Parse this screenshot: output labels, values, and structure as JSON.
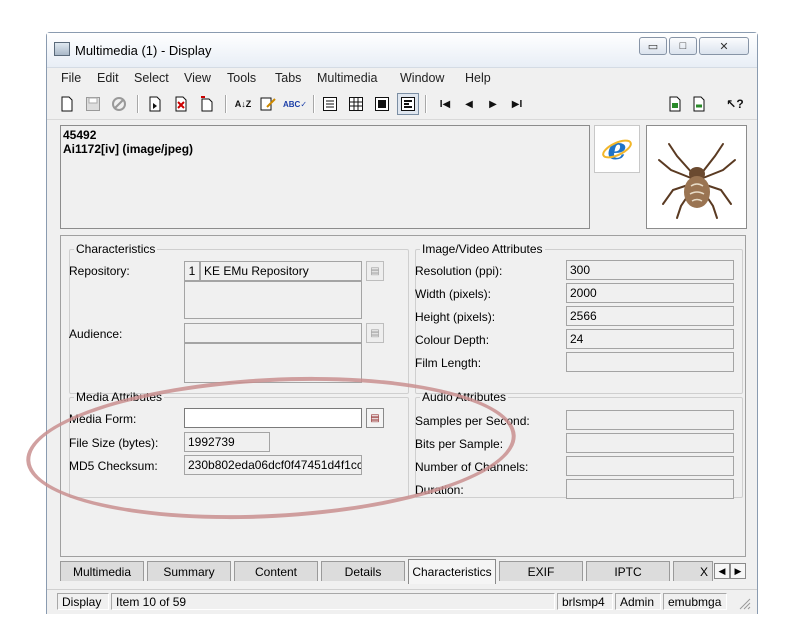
{
  "window": {
    "title": "Multimedia (1) - Display",
    "minimize": "▭",
    "maximize": "□",
    "close": "✕"
  },
  "menu": [
    "File",
    "Edit",
    "Select",
    "View",
    "Tools",
    "Tabs",
    "Multimedia",
    "Window",
    "Help"
  ],
  "toolbar_icons": [
    "new-record-icon",
    "save-icon",
    "cancel-icon",
    "search-icon",
    "delete-icon",
    "copy-icon",
    "sort-icon",
    "edit-icon",
    "spellcheck-icon",
    "list-view-icon",
    "table-view-icon",
    "page-view-icon",
    "detail-view-icon",
    "first-record-icon",
    "previous-record-icon",
    "next-record-icon",
    "last-record-icon",
    "attach-icon",
    "export-icon",
    "help-icon"
  ],
  "toolbar_glyphs": {
    "sort": "A↓Z",
    "spell": "ABC✓",
    "first": "I◀",
    "prev": "◀",
    "next": "▶",
    "last": "▶I",
    "help": "↖?"
  },
  "header": {
    "line1": "45492",
    "line2": "Ai1172[iv] (image/jpeg)"
  },
  "characteristics": {
    "legend": "Characteristics",
    "repository_label": "Repository:",
    "repository_index": "1",
    "repository_value": "KE EMu Repository",
    "audience_label": "Audience:"
  },
  "image_video": {
    "legend": "Image/Video Attributes",
    "fields": [
      {
        "label": "Resolution (ppi):",
        "value": "300"
      },
      {
        "label": "Width (pixels):",
        "value": "2000"
      },
      {
        "label": "Height (pixels):",
        "value": "2566"
      },
      {
        "label": "Colour Depth:",
        "value": "24"
      },
      {
        "label": "Film Length:",
        "value": ""
      }
    ]
  },
  "media": {
    "legend": "Media Attributes",
    "form_label": "Media Form:",
    "form_value": "",
    "size_label": "File Size (bytes):",
    "size_value": "1992739",
    "md5_label": "MD5 Checksum:",
    "md5_value": "230b802eda06dcf0f47451d4f1cc"
  },
  "audio": {
    "legend": "Audio Attributes",
    "fields": [
      {
        "label": "Samples per Second:",
        "value": ""
      },
      {
        "label": "Bits per Sample:",
        "value": ""
      },
      {
        "label": "Number of Channels:",
        "value": ""
      },
      {
        "label": "Duration:",
        "value": ""
      }
    ]
  },
  "tabs": [
    "Multimedia",
    "Summary",
    "Content",
    "Details",
    "Characteristics",
    "EXIF",
    "IPTC",
    "X"
  ],
  "active_tab": "Characteristics",
  "tab_scroll": {
    "left": "◀",
    "right": "▶"
  },
  "status": {
    "mode": "Display",
    "item": "Item 10 of 59",
    "host": "brlsmp4",
    "user": "Admin",
    "db": "emubmga"
  },
  "colors": {
    "annotation": "#c98f8f",
    "ie_blue": "#1e73c8",
    "window_bg": "#f0f0f0"
  }
}
